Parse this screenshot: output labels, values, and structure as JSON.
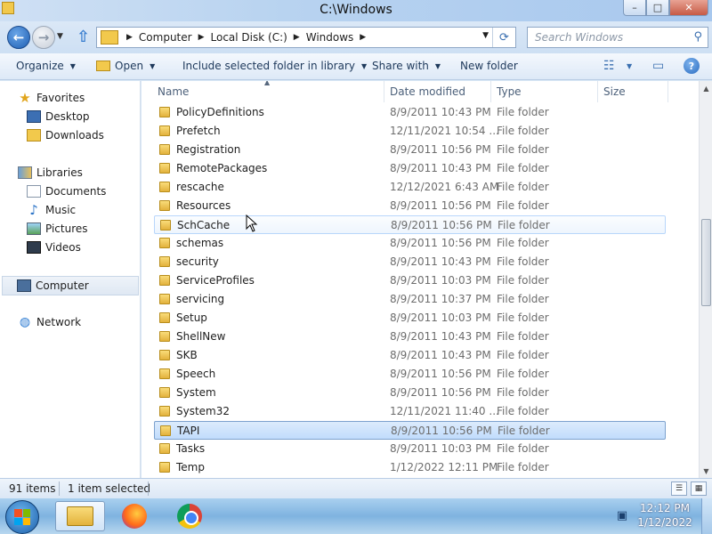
{
  "window": {
    "title": "C:\\Windows",
    "controls": {
      "minimize": "–",
      "maximize": "□",
      "close": "✕"
    }
  },
  "address": {
    "crumbs": [
      "Computer",
      "Local Disk (C:)",
      "Windows"
    ],
    "search_placeholder": "Search Windows"
  },
  "toolbar": {
    "organize": "Organize",
    "open": "Open",
    "include": "Include selected folder in library",
    "share": "Share with",
    "new_folder": "New folder"
  },
  "nav": {
    "favorites": "Favorites",
    "desktop": "Desktop",
    "downloads": "Downloads",
    "libraries": "Libraries",
    "documents": "Documents",
    "music": "Music",
    "pictures": "Pictures",
    "videos": "Videos",
    "computer": "Computer",
    "network": "Network"
  },
  "columns": {
    "name": "Name",
    "date": "Date modified",
    "type": "Type",
    "size": "Size"
  },
  "files": [
    {
      "name": "PolicyDefinitions",
      "date": "8/9/2011 10:43 PM",
      "type": "File folder"
    },
    {
      "name": "Prefetch",
      "date": "12/11/2021 10:54 ...",
      "type": "File folder"
    },
    {
      "name": "Registration",
      "date": "8/9/2011 10:56 PM",
      "type": "File folder"
    },
    {
      "name": "RemotePackages",
      "date": "8/9/2011 10:43 PM",
      "type": "File folder"
    },
    {
      "name": "rescache",
      "date": "12/12/2021 6:43 AM",
      "type": "File folder"
    },
    {
      "name": "Resources",
      "date": "8/9/2011 10:56 PM",
      "type": "File folder"
    },
    {
      "name": "SchCache",
      "date": "8/9/2011 10:56 PM",
      "type": "File folder"
    },
    {
      "name": "schemas",
      "date": "8/9/2011 10:56 PM",
      "type": "File folder"
    },
    {
      "name": "security",
      "date": "8/9/2011 10:43 PM",
      "type": "File folder"
    },
    {
      "name": "ServiceProfiles",
      "date": "8/9/2011 10:03 PM",
      "type": "File folder"
    },
    {
      "name": "servicing",
      "date": "8/9/2011 10:37 PM",
      "type": "File folder"
    },
    {
      "name": "Setup",
      "date": "8/9/2011 10:03 PM",
      "type": "File folder"
    },
    {
      "name": "ShellNew",
      "date": "8/9/2011 10:43 PM",
      "type": "File folder"
    },
    {
      "name": "SKB",
      "date": "8/9/2011 10:43 PM",
      "type": "File folder"
    },
    {
      "name": "Speech",
      "date": "8/9/2011 10:56 PM",
      "type": "File folder"
    },
    {
      "name": "System",
      "date": "8/9/2011 10:56 PM",
      "type": "File folder"
    },
    {
      "name": "System32",
      "date": "12/11/2021 11:40 ...",
      "type": "File folder"
    },
    {
      "name": "TAPI",
      "date": "8/9/2011 10:56 PM",
      "type": "File folder"
    },
    {
      "name": "Tasks",
      "date": "8/9/2011 10:03 PM",
      "type": "File folder"
    },
    {
      "name": "Temp",
      "date": "1/12/2022 12:11 PM",
      "type": "File folder"
    }
  ],
  "hover_index": 6,
  "selected_index": 17,
  "status": {
    "count": "91 items",
    "selection": "1 item selected"
  },
  "taskbar": {
    "time": "12:12 PM",
    "date": "1/12/2022"
  },
  "icons": {
    "back": "back-arrow-icon",
    "forward": "forward-arrow-icon",
    "up": "up-arrow-icon",
    "refresh": "refresh-icon",
    "search": "search-icon",
    "help": "help-icon",
    "folder": "folder-icon"
  }
}
